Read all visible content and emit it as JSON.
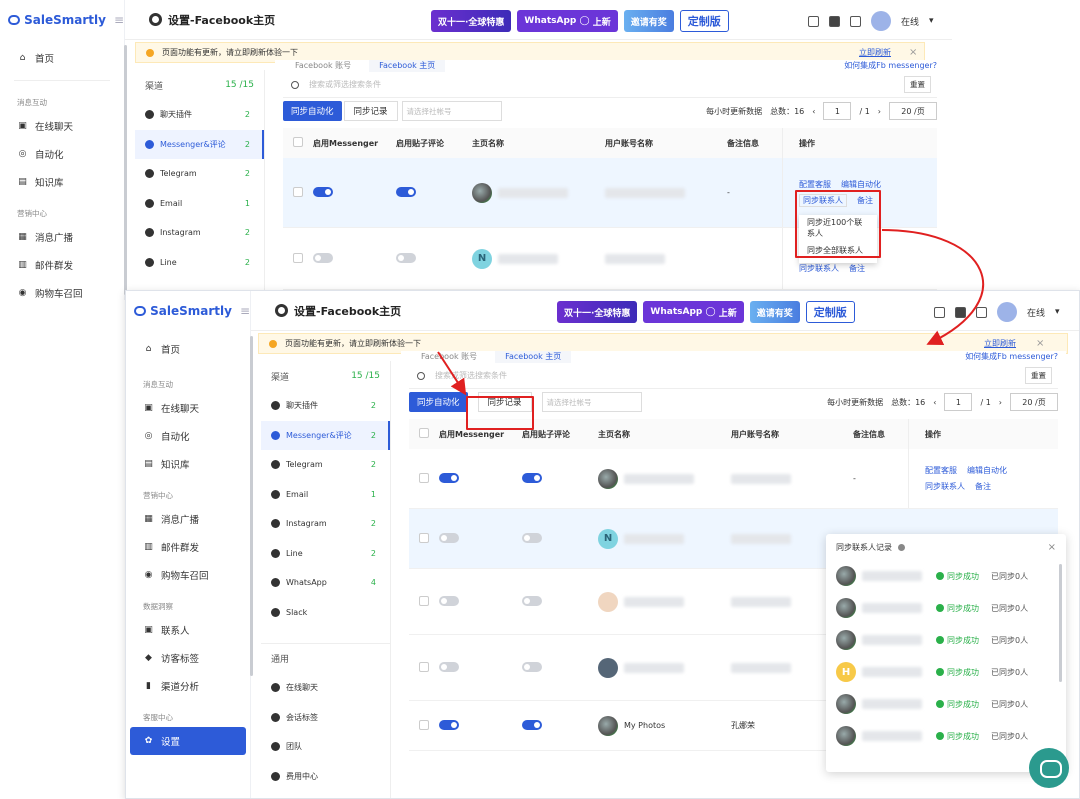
{
  "app": {
    "logo": "SaleSmartly",
    "page_title": "设置-Facebook主页",
    "status": "在线"
  },
  "promos": {
    "double11": "双十一·全球特惠",
    "whatsapp_new": "New",
    "whatsapp": "WhatsApp",
    "whatsapp_suffix": "上新",
    "invite": "邀请有奖",
    "custom": "定制版"
  },
  "nav": {
    "home": "首页",
    "sec_interact": "消息互动",
    "live_chat": "在线聊天",
    "automation": "自动化",
    "knowledge": "知识库",
    "sec_marketing": "营销中心",
    "broadcast": "消息广播",
    "email_mass": "邮件群发",
    "cart_recall": "购物车召回",
    "sec_data": "数据洞察",
    "contacts": "联系人",
    "visitor_tags": "访客标签",
    "channel_analysis": "渠道分析",
    "sec_service": "客服中心",
    "settings": "设置"
  },
  "notice": {
    "text": "页面功能有更新，请立即刷新体验一下",
    "refresh": "立即刷新",
    "close": "×"
  },
  "channels": {
    "title": "渠道",
    "count": "15 /15",
    "items": [
      {
        "label": "聊天插件",
        "n": "2"
      },
      {
        "label": "Messenger&评论",
        "n": "2"
      },
      {
        "label": "Telegram",
        "n": "2"
      },
      {
        "label": "Email",
        "n": "1"
      },
      {
        "label": "Instagram",
        "n": "2"
      },
      {
        "label": "Line",
        "n": "2"
      },
      {
        "label": "WhatsApp",
        "n": "4"
      },
      {
        "label": "Slack",
        "n": ""
      }
    ],
    "sec_general": "通用",
    "general": [
      "在线聊天",
      "会话标签",
      "团队",
      "费用中心"
    ]
  },
  "tabs": {
    "fb_account": "Facebook 账号",
    "fb_page": "Facebook 主页",
    "help": "如何集成Fb messenger?"
  },
  "toolbar": {
    "search_placeholder": "搜索或筛选搜索条件",
    "reset": "重置",
    "sync_auto": "同步自动化",
    "sync_record": "同步记录",
    "account_placeholder": "请选择社帐号",
    "update_hint": "每小时更新数据",
    "total": "总数：16",
    "page": "1",
    "page_total": "/ 1",
    "per_page": "20 /页"
  },
  "table": {
    "headers": [
      "启用Messenger",
      "启用贴子评论",
      "主页名称",
      "用户账号名称",
      "备注信息",
      "操作"
    ],
    "dash": "-",
    "actions": {
      "config_reply": "配置客服",
      "edit_auto": "编辑自动化",
      "sync_contacts": "同步联系人",
      "note": "备注"
    },
    "last_row_name": "My Photos",
    "last_row_user": "孔娜荣"
  },
  "dropdown": {
    "recent100": "同步近100个联系人",
    "all": "同步全部联系人"
  },
  "panel": {
    "title": "同步联系人记录",
    "close": "×",
    "status": "同步成功",
    "count": "已同步0人",
    "rows": 6,
    "avatars": [
      "",
      "",
      "",
      "H",
      "",
      ""
    ]
  }
}
